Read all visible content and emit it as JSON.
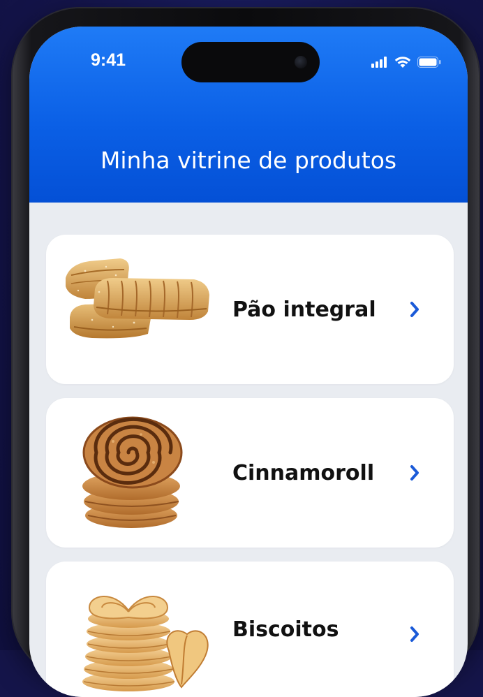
{
  "status_bar": {
    "time": "9:41",
    "icons": [
      "cellular-signal-icon",
      "wifi-icon",
      "battery-icon"
    ]
  },
  "header": {
    "title": "Minha vitrine de produtos"
  },
  "products": [
    {
      "name": "Pão integral",
      "image": "puff-pastry-image",
      "action_icon": "chevron-right-icon"
    },
    {
      "name": "Cinnamoroll",
      "image": "cinnamon-roll-image",
      "action_icon": "chevron-right-icon"
    },
    {
      "name": "Biscoitos",
      "image": "palmier-cookies-image",
      "action_icon": "chevron-right-icon"
    }
  ],
  "colors": {
    "header_blue": "#0b60e6",
    "accent_blue": "#1a5ad8",
    "page_background": "#15154a",
    "list_background": "#e9ecf1"
  }
}
